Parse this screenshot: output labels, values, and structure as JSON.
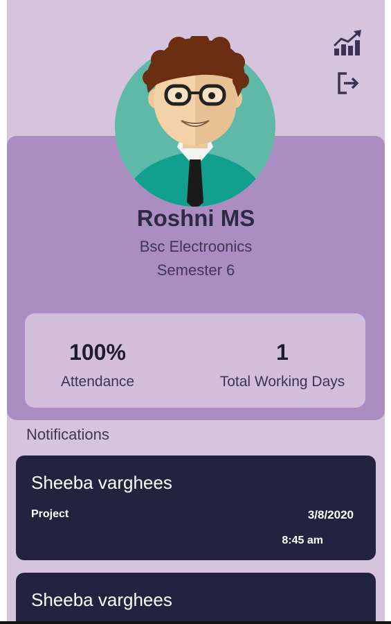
{
  "header": {
    "icons": [
      "chart-growth-icon",
      "logout-icon"
    ]
  },
  "profile": {
    "name": "Roshni MS",
    "course": "Bsc Electroonics",
    "semester": "Semester 6"
  },
  "stats": {
    "attendance_value": "100%",
    "attendance_label": "Attendance",
    "working_days_value": "1",
    "working_days_label": "Total Working Days"
  },
  "notifications": {
    "heading": "Notifications",
    "items": [
      {
        "sender": "Sheeba varghees",
        "type": "Project",
        "date": "3/8/2020",
        "time": "8:45 am"
      },
      {
        "sender": "Sheeba varghees"
      }
    ]
  },
  "colors": {
    "background": "#d6c3dd",
    "profile_card": "#ab8dc1",
    "stats_box": "#d3bfdc",
    "notification_card": "#23233f",
    "avatar_circle": "#5fb9a8",
    "text_dark": "#2e2a45"
  }
}
